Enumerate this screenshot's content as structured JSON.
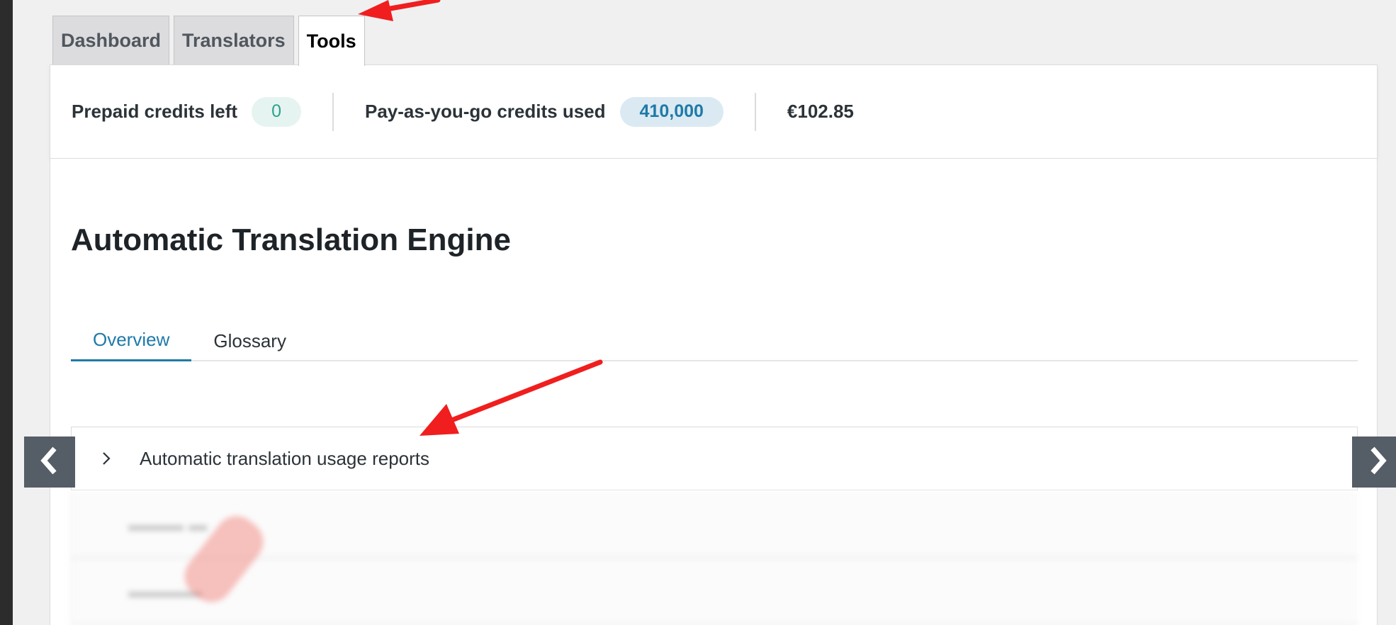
{
  "nav_tabs": [
    {
      "label": "Dashboard",
      "active": false
    },
    {
      "label": "Translators",
      "active": false
    },
    {
      "label": "Tools",
      "active": true
    }
  ],
  "credits": {
    "prepaid_label": "Prepaid credits left",
    "prepaid_value": "0",
    "payg_label": "Pay-as-you-go credits used",
    "payg_value": "410,000",
    "amount": "€102.85"
  },
  "page": {
    "title": "Automatic Translation Engine"
  },
  "sub_tabs": [
    {
      "label": "Overview",
      "active": true
    },
    {
      "label": "Glossary",
      "active": false
    }
  ],
  "accordion": {
    "label": "Automatic translation usage reports"
  },
  "colors": {
    "accent": "#1e7aa8",
    "annotation_arrow": "#f01e1e",
    "prepaid_pill_text": "#2ba38f"
  },
  "icons": {
    "accordion": "chevron-right-icon",
    "carousel_prev": "chevron-left-icon",
    "carousel_next": "chevron-right-icon"
  }
}
